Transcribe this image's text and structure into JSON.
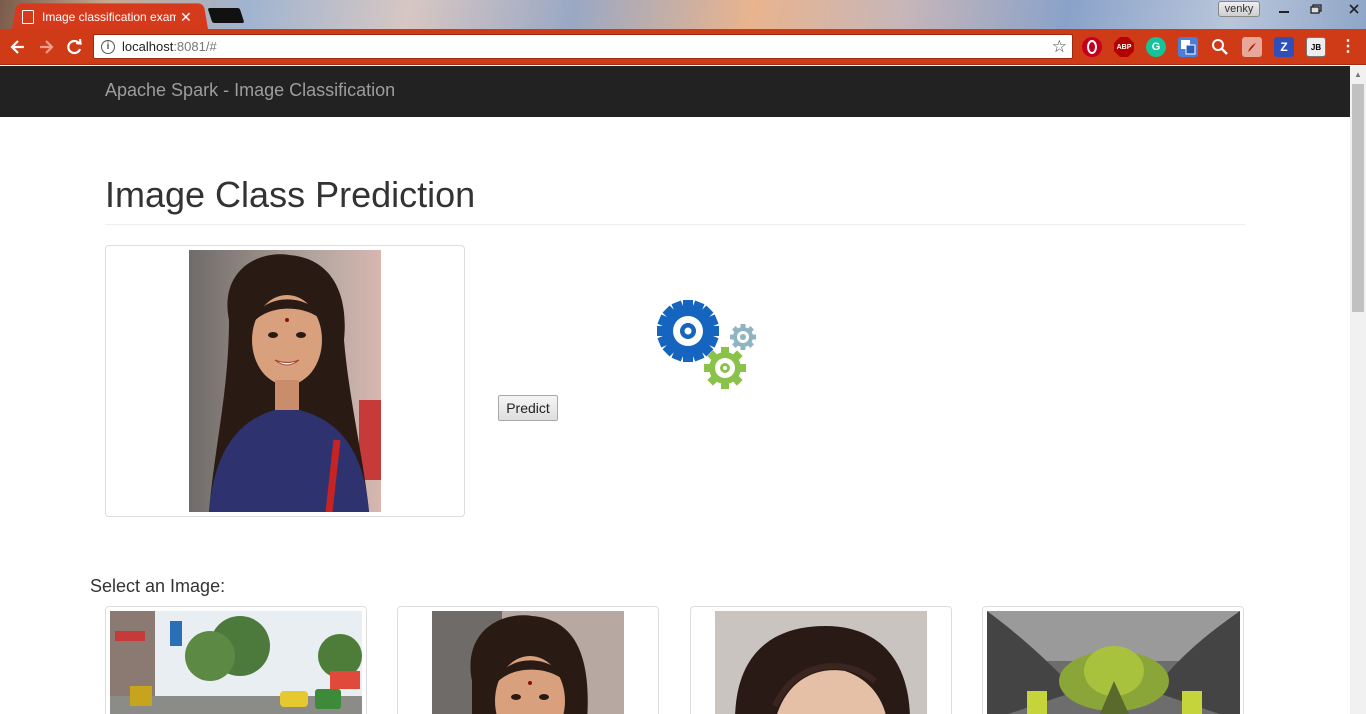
{
  "browser": {
    "tab_title": "Image classification exam",
    "profile_name": "venky",
    "url_host": "localhost",
    "url_rest": ":8081/#",
    "extensions": [
      "opera-icon",
      "adblock-icon",
      "grammarly-icon",
      "translate-icon",
      "zoom-icon",
      "pdf-icon",
      "zotero-icon",
      "jb-icon"
    ],
    "extension_labels": {
      "abp": "ABP",
      "zotero": "Z",
      "jb": "JB",
      "grammarly": "G"
    }
  },
  "navbar": {
    "brand": "Apache Spark - Image Classification"
  },
  "main": {
    "title": "Image Class Prediction",
    "predict_label": "Predict",
    "select_label": "Select an Image:"
  },
  "colors": {
    "chrome_red": "#cf3a17",
    "navbar_bg": "#222222",
    "brand_text": "#9d9d9d",
    "gear_blue": "#1565c0",
    "gear_green": "#8bc34a",
    "gear_gray": "#90b4c4"
  }
}
